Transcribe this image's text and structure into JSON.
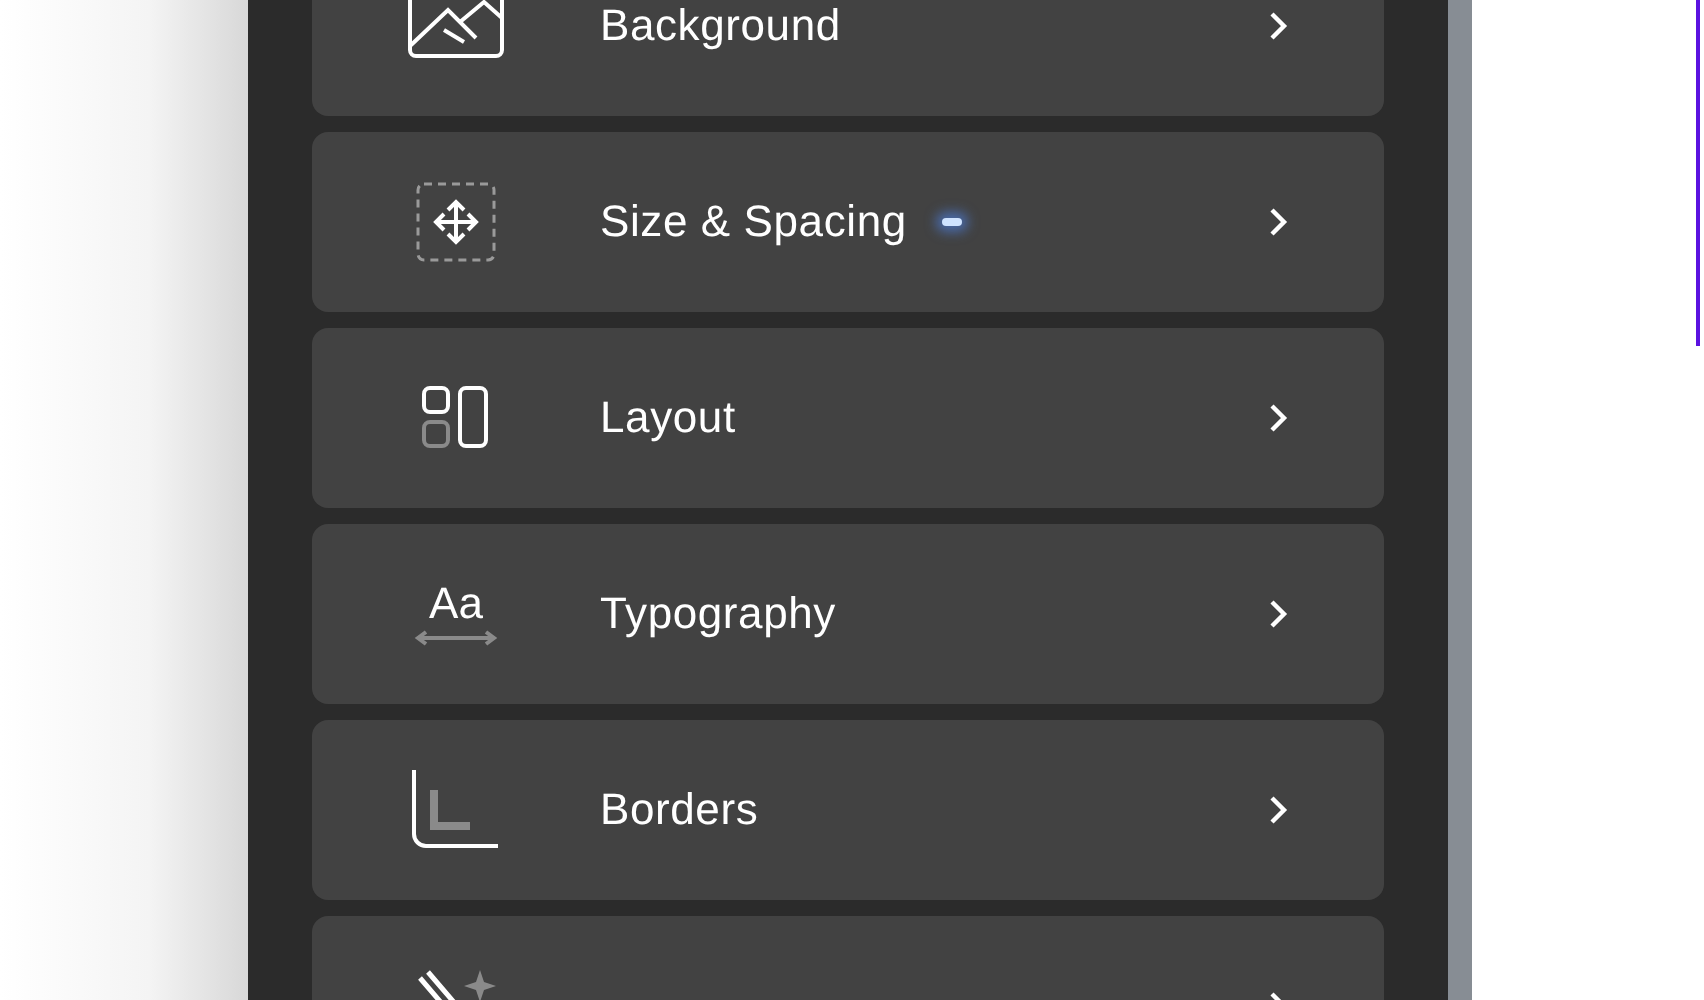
{
  "panel": {
    "items": [
      {
        "kind": "background",
        "label": "Background",
        "modified": false
      },
      {
        "kind": "size",
        "label": "Size & Spacing",
        "modified": true
      },
      {
        "kind": "layout",
        "label": "Layout",
        "modified": false
      },
      {
        "kind": "typography",
        "label": "Typography",
        "icon_text": "Aa",
        "modified": false
      },
      {
        "kind": "borders",
        "label": "Borders",
        "modified": false
      },
      {
        "kind": "effects",
        "modified": false
      }
    ]
  }
}
